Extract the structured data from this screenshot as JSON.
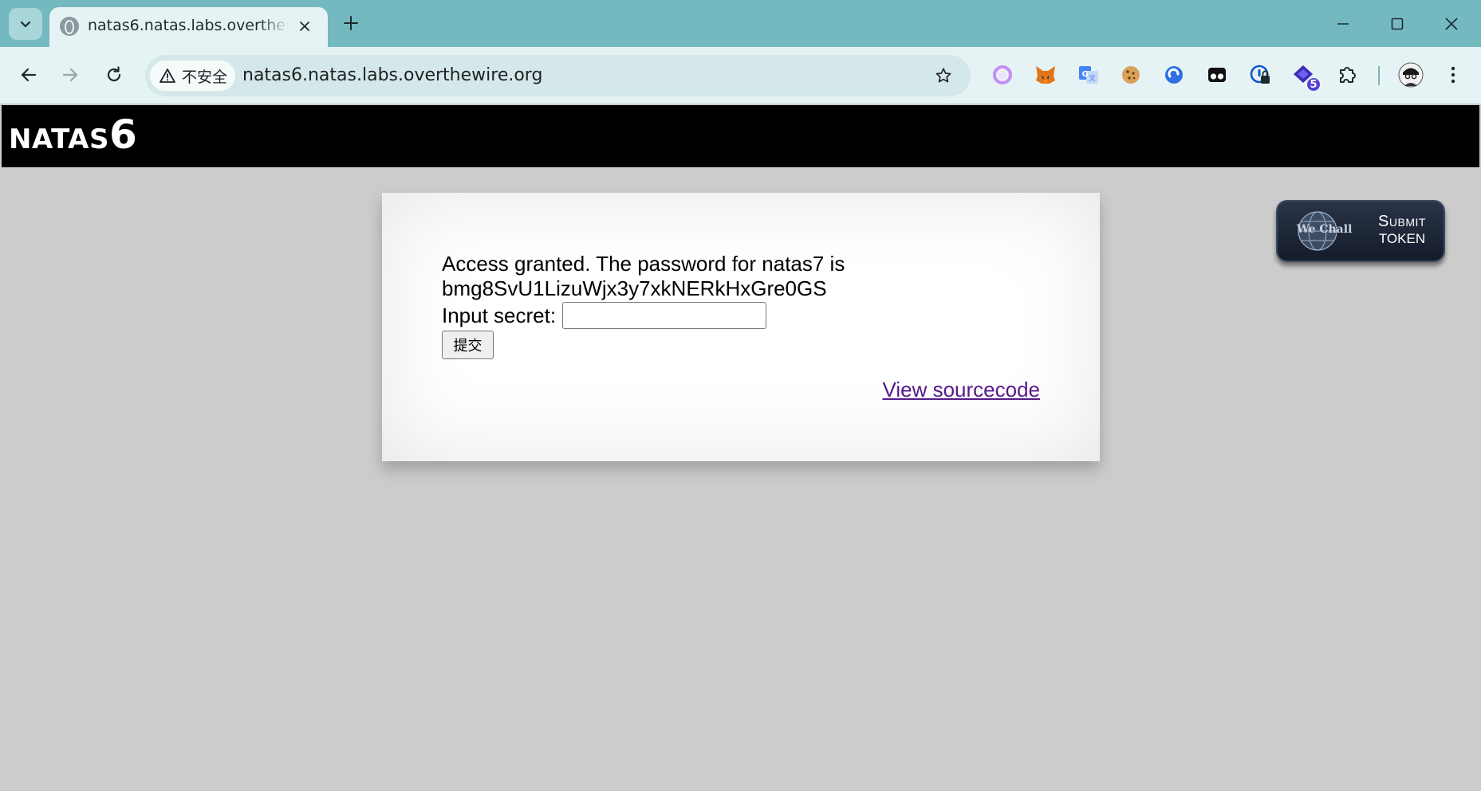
{
  "browser": {
    "tab": {
      "title": "natas6.natas.labs.overthewire.org"
    },
    "security_label": "不安全",
    "url": "natas6.natas.labs.overthewire.org",
    "extensions": [
      "circle-extension-icon",
      "metamask-fox-icon",
      "google-translate-icon",
      "cookie-icon",
      "edge-blue-icon",
      "tampermonkey-icon",
      "password-manager-icon",
      "wechall-shield-icon",
      "puzzle-extensions-icon"
    ],
    "extension_badge": "5",
    "colors": {
      "frame": "#74b9c0",
      "toolbar": "#e6f3f4"
    }
  },
  "page": {
    "header": {
      "title_prefix": "NATAS",
      "title_number": "6"
    },
    "message_line1": "Access granted. The password for natas7 is",
    "message_line2": "bmg8SvU1LizuWjx3y7xkNERkHxGre0GS",
    "secret_label": "Input secret:",
    "secret_value": "",
    "submit_label": "提交",
    "source_link": "View sourcecode",
    "wechall": {
      "logo_text": "We Chall",
      "line1": "Submit",
      "line2": "TOKEN"
    },
    "colors": {
      "background": "#cccccc",
      "header": "#000000",
      "link": "#551a8b"
    }
  }
}
